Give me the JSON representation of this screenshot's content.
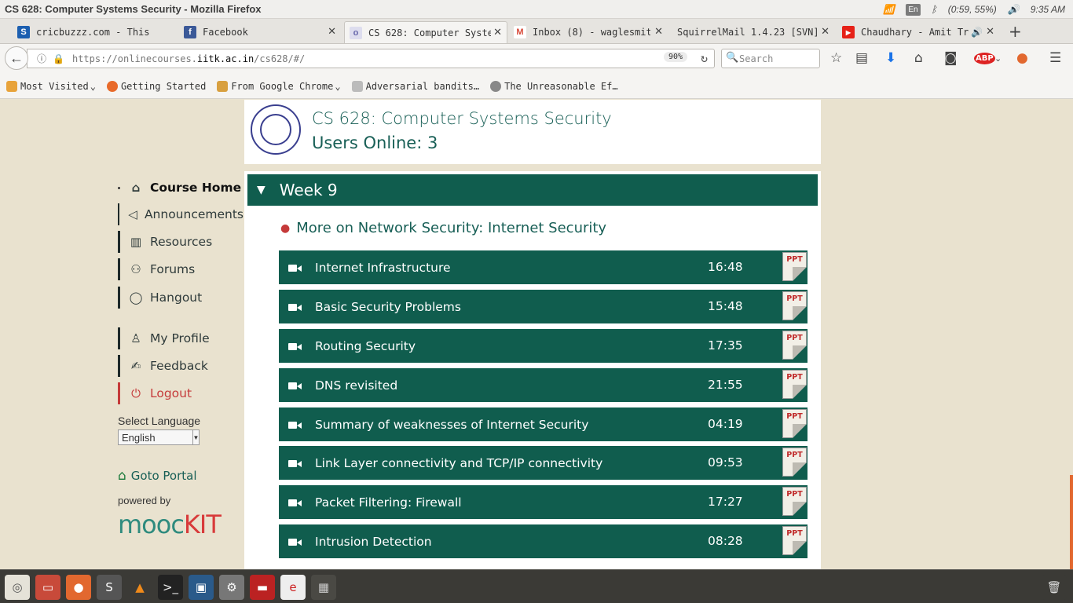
{
  "window": {
    "title": "CS 628: Computer Systems Security - Mozilla Firefox",
    "lang": "En",
    "battery": "(0:59, 55%)",
    "clock": "9:35 AM"
  },
  "tabs": [
    {
      "label": "cricbuzzz.com - This w",
      "icon": "S",
      "color": "#1c5fb0"
    },
    {
      "label": "Facebook",
      "icon": "f",
      "color": "#3b5998"
    },
    {
      "label": "CS 628: Computer Syste",
      "icon": "o",
      "color": "#8888cc"
    },
    {
      "label": "Inbox (8) - waglesmit.",
      "icon": "M",
      "color": "#d84a3a"
    },
    {
      "label": "SquirrelMail 1.4.23 [SVN]",
      "icon": "",
      "color": "#f5f4f2"
    },
    {
      "label": "Chaudhary - Amit Tr",
      "icon": "▶",
      "color": "#e62117"
    }
  ],
  "nav": {
    "url_prefix": "https://onlinecourses.",
    "url_domain": "iitk.ac.in",
    "url_suffix": "/cs628/#/",
    "zoom": "90%",
    "search_placeholder": "Search"
  },
  "bookmarks": [
    {
      "label": "Most Visited",
      "color": "#e8a33a"
    },
    {
      "label": "Getting Started",
      "color": "#e86a2a"
    },
    {
      "label": "From Google Chrome",
      "color": "#d8a040"
    },
    {
      "label": "Adversarial bandits…",
      "color": "#999"
    },
    {
      "label": "The Unreasonable Ef…",
      "color": "#777"
    }
  ],
  "header": {
    "title": "CS 628: Computer Systems Security",
    "users": "Users Online: 3"
  },
  "sidebar": {
    "items": [
      {
        "label": "Course Home",
        "icon": "⌂"
      },
      {
        "label": "Announcements",
        "icon": "📢"
      },
      {
        "label": "Resources",
        "icon": "📖"
      },
      {
        "label": "Forums",
        "icon": "👥"
      },
      {
        "label": "Hangout",
        "icon": "💬"
      },
      {
        "label": "My Profile",
        "icon": "👤"
      },
      {
        "label": "Feedback",
        "icon": "✍"
      },
      {
        "label": "Logout",
        "icon": "⏻"
      }
    ],
    "select_label": "Select Language",
    "language": "English",
    "goto": "Goto Portal",
    "powered": "powered by",
    "brand_a": "mooc",
    "brand_b": "KIT"
  },
  "week": {
    "title": "Week 9",
    "topic": "More on Network Security: Internet Security",
    "lectures": [
      {
        "title": "Internet Infrastructure",
        "duration": "16:48"
      },
      {
        "title": "Basic Security Problems",
        "duration": "15:48"
      },
      {
        "title": "Routing Security",
        "duration": "17:35"
      },
      {
        "title": "DNS revisited",
        "duration": "21:55"
      },
      {
        "title": "Summary of weaknesses of Internet Security",
        "duration": "04:19"
      },
      {
        "title": "Link Layer connectivity and TCP/IP connectivity",
        "duration": "09:53"
      },
      {
        "title": "Packet Filtering: Firewall",
        "duration": "17:27"
      },
      {
        "title": "Intrusion Detection",
        "duration": "08:28"
      }
    ],
    "ppt_label": "PPT"
  }
}
